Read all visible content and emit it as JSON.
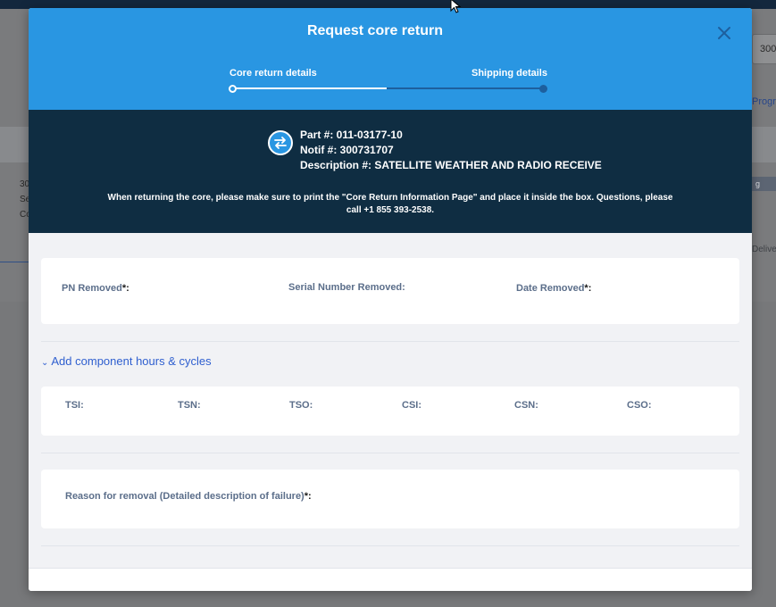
{
  "background": {
    "search_value": "300",
    "link_text": "Progre",
    "tag_text": "g",
    "deliver_text": "Delive",
    "left_lines": [
      "30",
      "Se",
      "Co"
    ]
  },
  "modal": {
    "title": "Request core return",
    "steps": [
      {
        "label": "Core return details",
        "state": "active"
      },
      {
        "label": "Shipping details",
        "state": "pending"
      }
    ],
    "part_number": "Part #: 011-03177-10",
    "notif_number": "Notif #: 300731707",
    "description": "Description #: SATELLITE WEATHER AND RADIO RECEIVE",
    "notice": "When returning the core, please make sure to print the \"Core Return Information Page\" and place it inside the box. Questions, please call +1 855 393-2538.",
    "removal_fields": {
      "pn_removed": "PN Removed",
      "serial_removed": "Serial Number Removed:",
      "date_removed": "Date Removed"
    },
    "required_mark": "*:",
    "toggle_label": "Add component hours & cycles",
    "hours_fields": [
      "TSI:",
      "TSN:",
      "TSO:",
      "CSI:",
      "CSN:",
      "CSO:"
    ],
    "reason_label": "Reason for removal (Detailed description of failure)"
  },
  "colors": {
    "header_blue": "#2996e2",
    "dark_band": "#0f2d42",
    "link_blue": "#2f5fcf",
    "label_gray": "#5b6e8a"
  },
  "icons": {
    "close": "close-icon",
    "swap": "swap-arrows-icon",
    "chevron": "chevron-down-icon",
    "cursor": "mouse-cursor-icon"
  }
}
